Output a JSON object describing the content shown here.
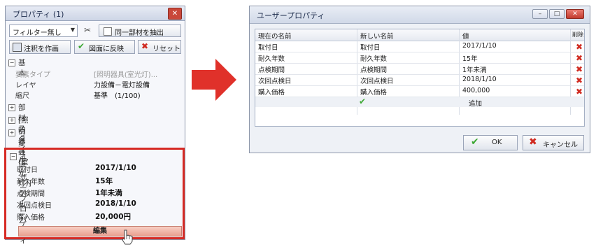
{
  "properties_panel": {
    "title": "プロパティ (1)",
    "filter_select": "フィルター無し",
    "same_member_label": "同一部材を抽出",
    "annotate_button": "注釈を作画",
    "apply_button": "図面に反映",
    "reset_button": "リセット",
    "sections": {
      "basic": "基本",
      "member_style": "部材スタイル",
      "lighting_group": "[照明器具(室光灯)]グループ",
      "variable_dims": "可変寸法",
      "user_props": "ユーザープロパティ"
    },
    "basic_rows": [
      {
        "key": "要素タイプ",
        "value": "[照明器具(室光灯)..."
      },
      {
        "key": "レイヤ",
        "value": "力設備－電灯設備"
      },
      {
        "key": "縮尺",
        "value": "基準　(1/100)"
      }
    ],
    "user_rows": [
      {
        "key": "取付日",
        "value": "2017/1/10"
      },
      {
        "key": "耐久年数",
        "value": "15年"
      },
      {
        "key": "点検期間",
        "value": "1年未満"
      },
      {
        "key": "次回点検日",
        "value": "2018/1/10"
      },
      {
        "key": "購入価格",
        "value": "20,000円"
      }
    ],
    "edit_button": "編集"
  },
  "dialog": {
    "title": "ユーザープロパティ",
    "columns": [
      "現在の名前",
      "新しい名前",
      "値",
      "削除"
    ],
    "rows": [
      {
        "current": "取付日",
        "new": "取付日",
        "value": "2017/1/10"
      },
      {
        "current": "耐久年数",
        "new": "耐久年数",
        "value": "15年"
      },
      {
        "current": "点検期間",
        "new": "点検期間",
        "value": "1年未満"
      },
      {
        "current": "次回点検日",
        "new": "次回点検日",
        "value": "2018/1/10"
      },
      {
        "current": "購入価格",
        "new": "購入価格",
        "value": "400,000"
      }
    ],
    "add_label": "追加",
    "ok_button": "OK",
    "cancel_button": "キャンセル"
  },
  "colors": {
    "highlight_red": "#d62a24",
    "check_green": "#3da834",
    "delete_red": "#d02a20"
  },
  "icons": [
    "close-icon",
    "tool-icon",
    "checkbox-icon",
    "annotate-icon",
    "check-icon",
    "x-icon",
    "cursor-hand-icon",
    "arrow-right-icon"
  ]
}
